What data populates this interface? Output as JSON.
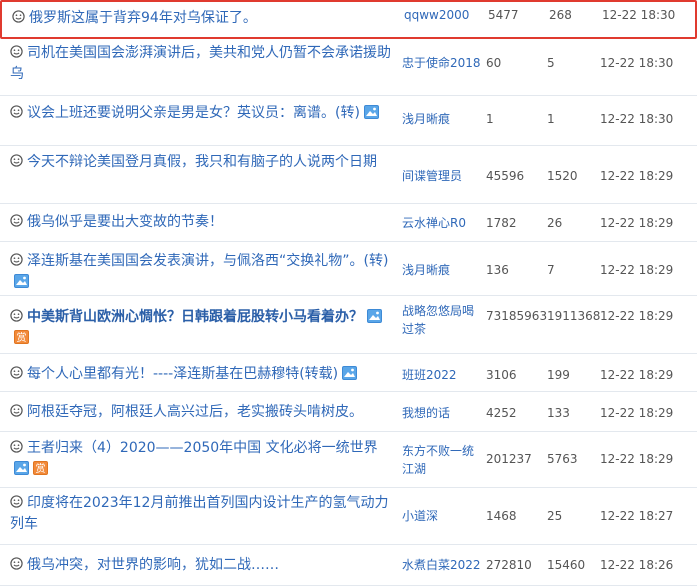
{
  "rows": [
    {
      "title": "俄罗斯这属于背弃94年对乌保证了。",
      "author": "qqww2000",
      "clicks": "5477",
      "replies": "268",
      "time": "12-22 18:30",
      "bold": false,
      "image_icon": false,
      "award_icon": false,
      "selected": true
    },
    {
      "title": "司机在美国国会澎湃演讲后，美共和党人仍暂不会承诺援助乌",
      "author": "忠于使命2018",
      "clicks": "60",
      "replies": "5",
      "time": "12-22 18:30",
      "bold": false,
      "image_icon": false,
      "award_icon": false,
      "selected": false
    },
    {
      "title": "议会上班还要说明父亲是男是女？英议员：离谱。(转)",
      "author": "浅月晰痕",
      "clicks": "1",
      "replies": "1",
      "time": "12-22 18:30",
      "bold": false,
      "image_icon": true,
      "award_icon": false,
      "selected": false
    },
    {
      "title": "今天不辩论美国登月真假，我只和有脑子的人说两个日期",
      "author": "间谍管理员",
      "clicks": "45596",
      "replies": "1520",
      "time": "12-22 18:29",
      "bold": false,
      "image_icon": false,
      "award_icon": false,
      "selected": false
    },
    {
      "title": "俄乌似乎是要出大变故的节奏！",
      "author": "云水禅心R0",
      "clicks": "1782",
      "replies": "26",
      "time": "12-22 18:29",
      "bold": false,
      "image_icon": false,
      "award_icon": false,
      "selected": false
    },
    {
      "title": "泽连斯基在美国国会发表演讲，与佩洛西“交换礼物”。(转)",
      "author": "浅月晰痕",
      "clicks": "136",
      "replies": "7",
      "time": "12-22 18:29",
      "bold": false,
      "image_icon": true,
      "award_icon": false,
      "selected": false
    },
    {
      "title": "中美斯背山欧洲心惆怅？日韩跟着屁股转小马看着办？",
      "author": "战略忽悠局喝过茶",
      "clicks": "73185963",
      "replies": "1911368",
      "time": "12-22 18:29",
      "bold": true,
      "image_icon": true,
      "award_icon": true,
      "selected": false
    },
    {
      "title": "每个人心里都有光！----泽连斯基在巴赫穆特(转载)",
      "author": "班班2022",
      "clicks": "3106",
      "replies": "199",
      "time": "12-22 18:29",
      "bold": false,
      "image_icon": true,
      "award_icon": false,
      "selected": false
    },
    {
      "title": "阿根廷夺冠，阿根廷人高兴过后，老实搬砖头啃树皮。",
      "author": "我想的话",
      "clicks": "4252",
      "replies": "133",
      "time": "12-22 18:29",
      "bold": false,
      "image_icon": false,
      "award_icon": false,
      "selected": false
    },
    {
      "title": "王者归来（4）2020——2050年中国 文化必将一统世界",
      "author": "东方不败一统江湖",
      "clicks": "201237",
      "replies": "5763",
      "time": "12-22 18:29",
      "bold": false,
      "image_icon": true,
      "award_icon": true,
      "selected": false
    },
    {
      "title": "印度将在2023年12月前推出首列国内设计生产的氢气动力列车",
      "author": "小道深",
      "clicks": "1468",
      "replies": "25",
      "time": "12-22 18:27",
      "bold": false,
      "image_icon": false,
      "award_icon": false,
      "selected": false
    },
    {
      "title": "俄乌冲突，对世界的影响，犹如二战……",
      "author": "水煮白菜2022",
      "clicks": "272810",
      "replies": "15460",
      "time": "12-22 18:26",
      "bold": false,
      "image_icon": false,
      "award_icon": false,
      "selected": false
    }
  ]
}
